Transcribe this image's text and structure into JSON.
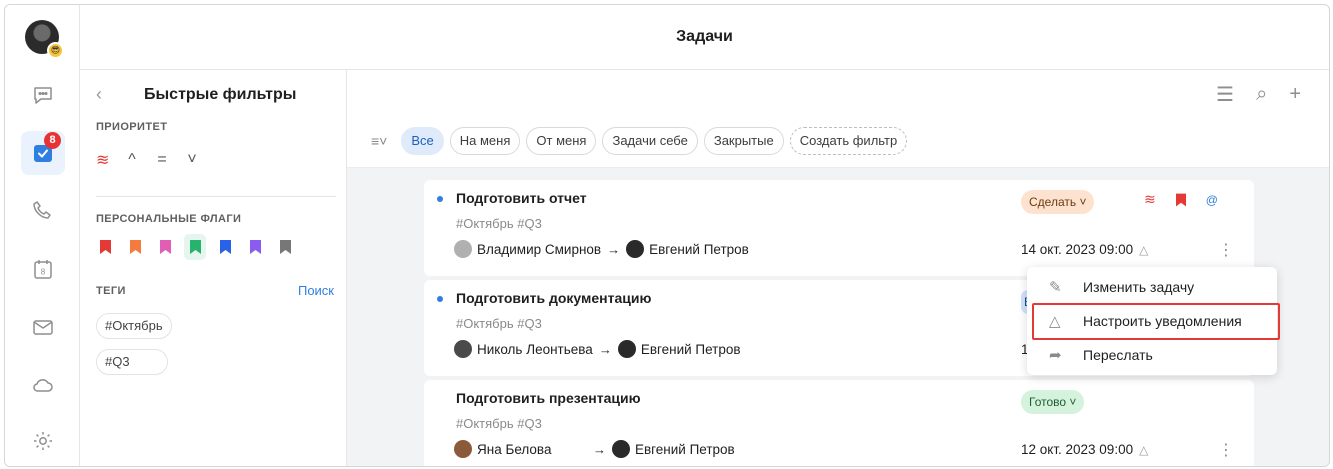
{
  "app": {
    "title": "Задачи"
  },
  "rail": {
    "items": [
      {
        "name": "messages",
        "icon": "chat-bubble-icon"
      },
      {
        "name": "tasks",
        "icon": "task-check-icon",
        "badge": "8",
        "active": true
      },
      {
        "name": "calls",
        "icon": "phone-icon"
      },
      {
        "name": "calendar",
        "icon": "calendar-icon",
        "day": "8"
      },
      {
        "name": "mail",
        "icon": "mail-icon"
      },
      {
        "name": "cloud",
        "icon": "cloud-icon"
      },
      {
        "name": "settings",
        "icon": "gear-icon"
      }
    ]
  },
  "filters": {
    "title": "Быстрые фильтры",
    "priority_label": "ПРИОРИТЕТ",
    "priority_icons": [
      "highest",
      "high",
      "medium",
      "low"
    ],
    "flags_label": "ПЕРСОНАЛЬНЫЕ ФЛАГИ",
    "flag_colors": [
      "#e53935",
      "#f47a3d",
      "#e05fb5",
      "#27b36e",
      "#2962e8",
      "#8a5cf0",
      "#777777"
    ],
    "tags_label": "ТЕГИ",
    "search_label": "Поиск",
    "tags": [
      "#Октябрь",
      "#Q3"
    ]
  },
  "chips": [
    {
      "label": "Все",
      "active": true
    },
    {
      "label": "На меня"
    },
    {
      "label": "От меня"
    },
    {
      "label": "Задачи себе"
    },
    {
      "label": "Закрытые"
    },
    {
      "label": "Создать фильтр",
      "dashed": true
    }
  ],
  "tasks": [
    {
      "title": "Подготовить отчет",
      "tags": "#Октябрь #Q3",
      "from": "Владимир Смирнов",
      "to": "Евгений Петров",
      "status": "Сделать",
      "date": "14 окт. 2023 09:00"
    },
    {
      "title": "Подготовить документацию",
      "tags": "#Октябрь #Q3",
      "from": "Николь Леонтьева",
      "to": "Евгений Петров",
      "status": "Е",
      "date": "13"
    },
    {
      "title": "Подготовить презентацию",
      "tags": "#Октябрь #Q3",
      "from": "Яна Белова",
      "to": "Евгений Петров",
      "status": "Готово",
      "date": "12 окт. 2023 09:00"
    }
  ],
  "context_menu": {
    "items": [
      {
        "label": "Изменить задачу",
        "icon": "pencil-icon"
      },
      {
        "label": "Настроить уведомления",
        "icon": "bell-icon",
        "highlighted": true
      },
      {
        "label": "Переслать",
        "icon": "forward-icon"
      }
    ]
  },
  "colors": {
    "accent": "#2f7fe0",
    "badge": "#e63434",
    "highlight": "#e53935",
    "status_todo": "#fde3cf",
    "status_done": "#d4f2dc"
  }
}
